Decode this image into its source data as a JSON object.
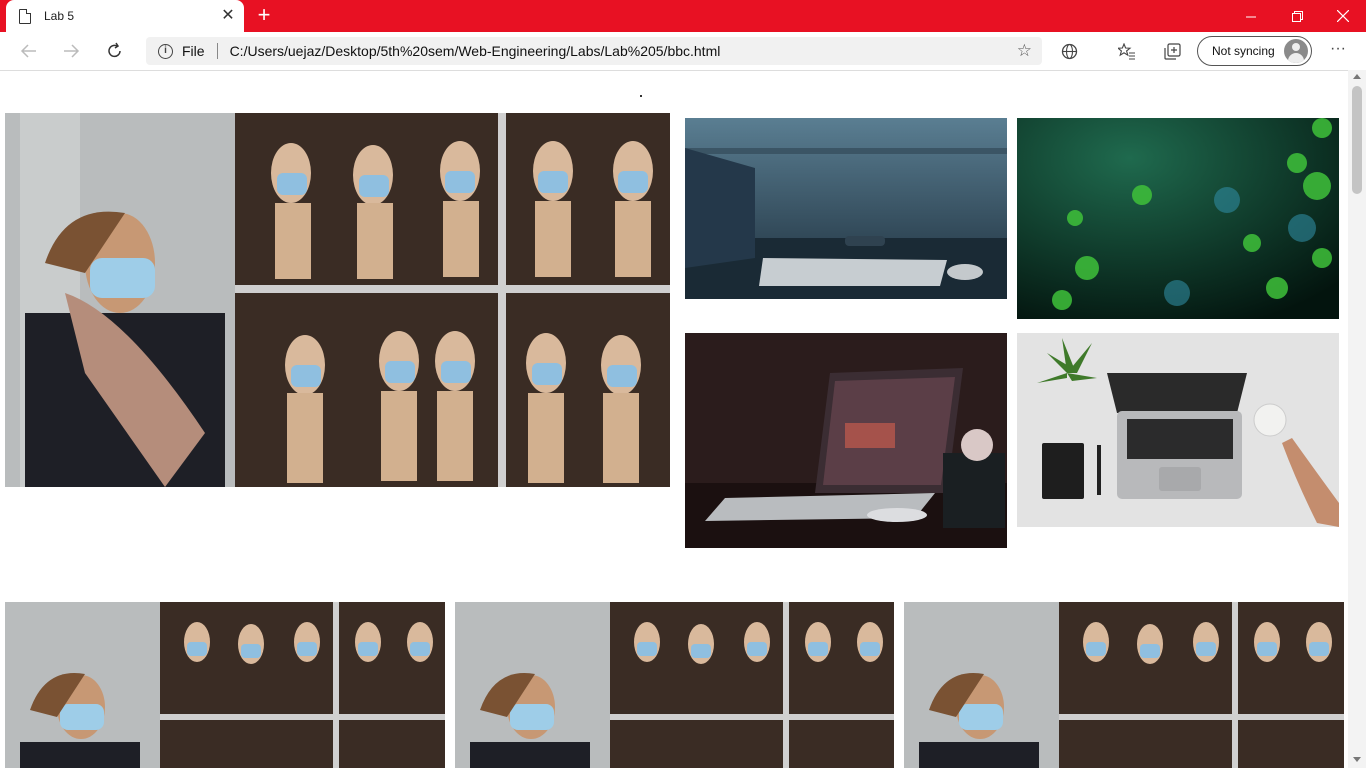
{
  "browser": {
    "tab_title": "Lab 5",
    "address_scheme": "File",
    "url": "C:/Users/uejaz/Desktop/5th%20sem/Web-Engineering/Labs/Lab%205/bbc.html",
    "sync_label": "Not syncing"
  },
  "page": {
    "images": [
      {
        "name": "masks-mannequins-hero-image",
        "alt": "Woman in mask beside mannequins wearing masks"
      },
      {
        "name": "laptop-keyboard-desk-image",
        "alt": "Keyboard on desk by window"
      },
      {
        "name": "green-bokeh-image",
        "alt": "Green bokeh lights"
      },
      {
        "name": "laptop-dark-desk-image",
        "alt": "Laptop on dark desk"
      },
      {
        "name": "laptop-top-view-image",
        "alt": "Laptop with plant, notebook and coffee"
      },
      {
        "name": "masks-thumb-1-image",
        "alt": "Mannequins with masks"
      },
      {
        "name": "masks-thumb-2-image",
        "alt": "Mannequins with masks"
      },
      {
        "name": "masks-thumb-3-image",
        "alt": "Mannequins with masks"
      }
    ]
  },
  "colors": {
    "titlebar": "#e81123",
    "toolbar": "#ffffff",
    "address_bg": "#f1f1f1"
  }
}
